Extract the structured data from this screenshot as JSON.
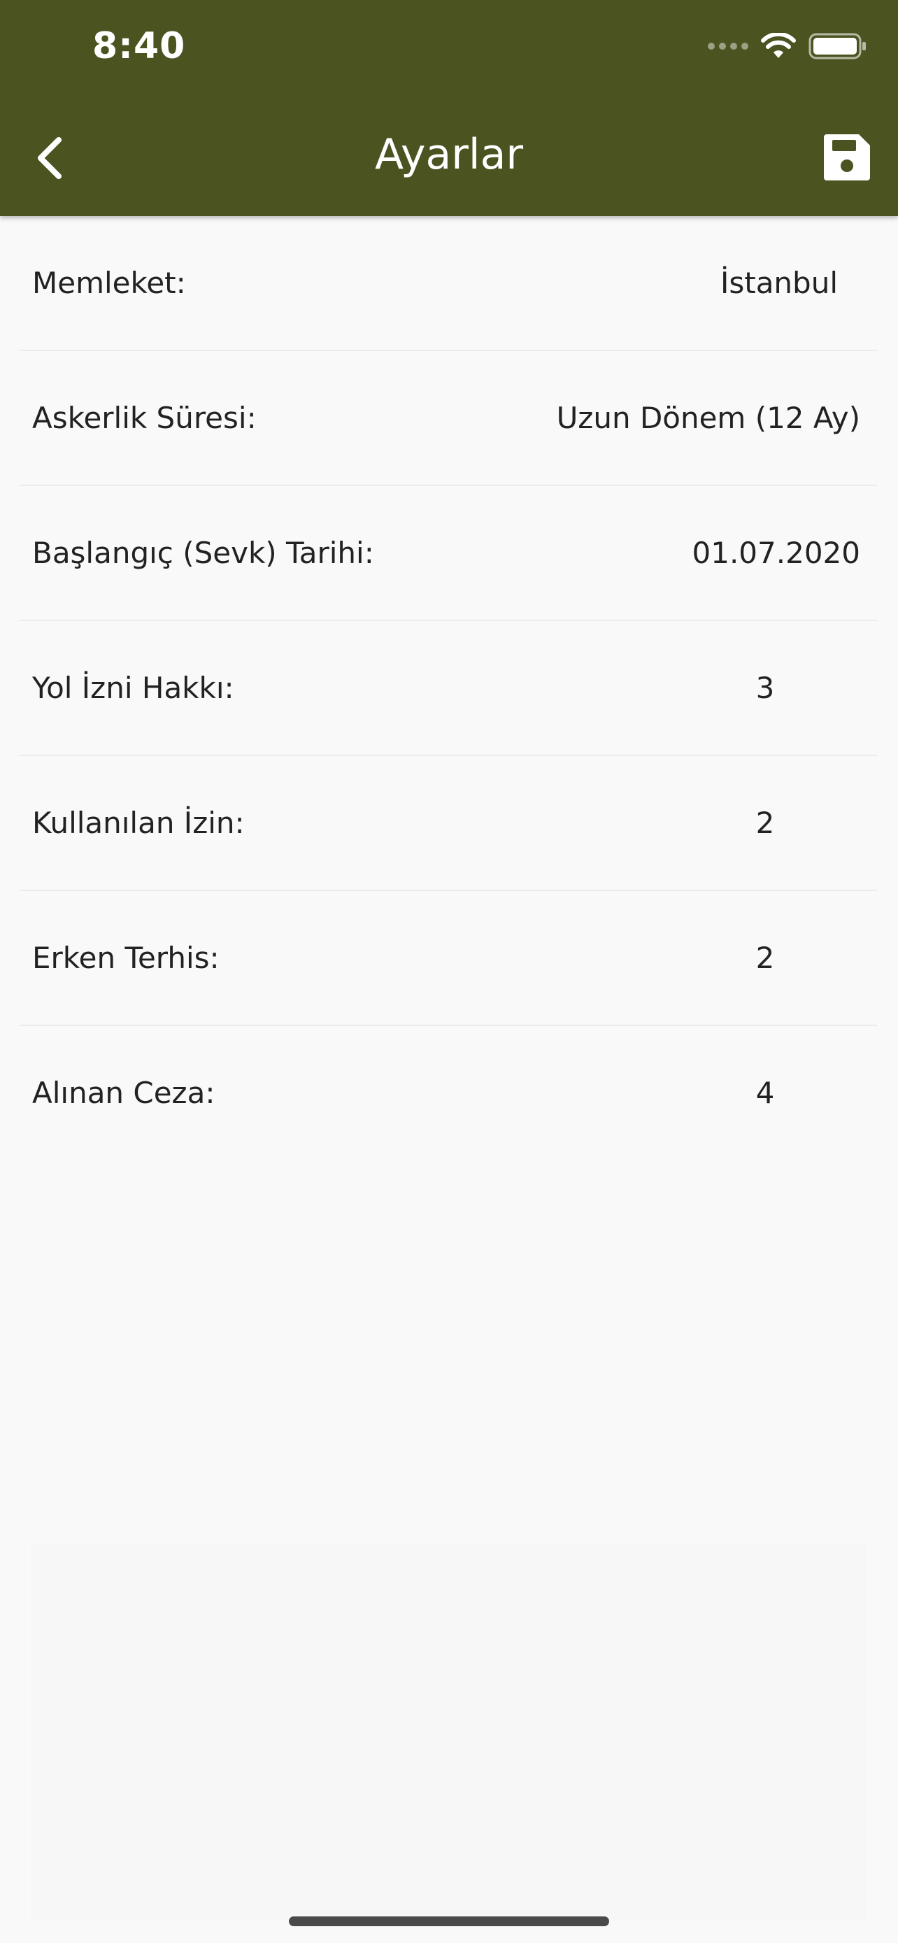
{
  "status_bar": {
    "time": "8:40"
  },
  "nav_bar": {
    "title": "Ayarlar",
    "back_icon": "chevron-left-icon",
    "save_icon": "floppy-disk-icon"
  },
  "colors": {
    "header_bg": "#4b5320",
    "page_bg": "#f9f9f9",
    "text": "#222222",
    "divider": "#ebebeb"
  },
  "settings": [
    {
      "label": "Memleket:",
      "value": "İstanbul"
    },
    {
      "label": "Askerlik Süresi:",
      "value": "Uzun Dönem (12 Ay)"
    },
    {
      "label": "Başlangıç (Sevk) Tarihi:",
      "value": "01.07.2020"
    },
    {
      "label": "Yol İzni Hakkı:",
      "value": "3"
    },
    {
      "label": "Kullanılan İzin:",
      "value": "2"
    },
    {
      "label": "Erken Terhis:",
      "value": "2"
    },
    {
      "label": "Alınan Ceza:",
      "value": "4"
    }
  ]
}
